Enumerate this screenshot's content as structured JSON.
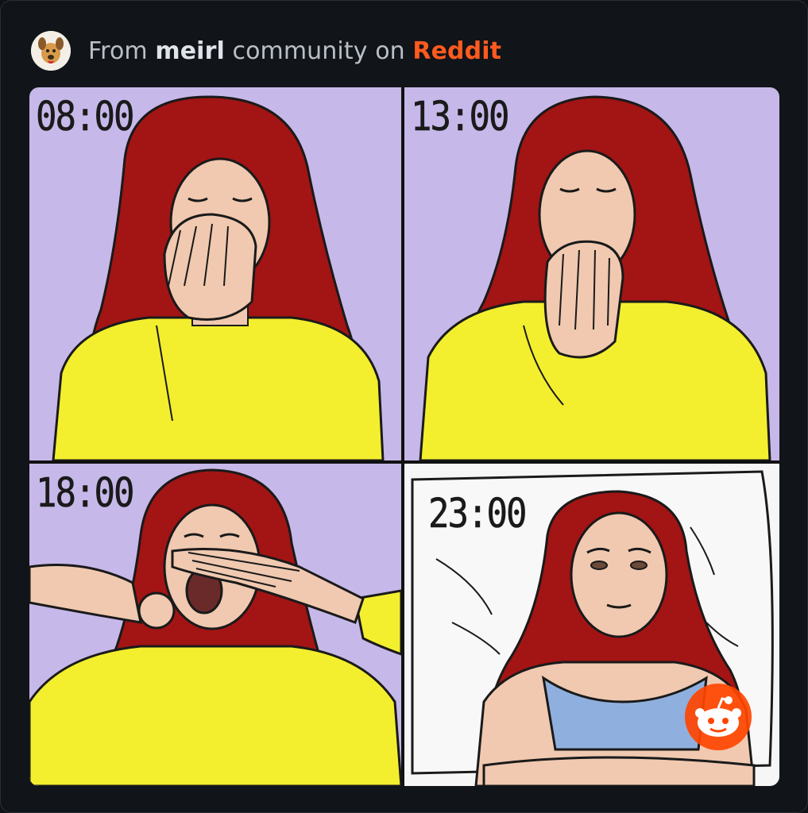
{
  "header": {
    "prefix": "From",
    "community": "meirl",
    "middle": "community on",
    "brand": "Reddit",
    "avatar_icon": "community-avatar-icon"
  },
  "comic": {
    "panels": [
      {
        "time": "08:00",
        "bg": "#c7b8ea"
      },
      {
        "time": "13:00",
        "bg": "#c7b8ea"
      },
      {
        "time": "18:00",
        "bg": "#c7b8ea"
      },
      {
        "time": "23:00",
        "bg": "#f6f6f6"
      }
    ]
  },
  "colors": {
    "brand": "#ff5a1f",
    "hair": "#a31414",
    "sweater": "#f3ef2e",
    "skin": "#f0c9b0",
    "tank_top": "#8fb0de",
    "panel_bg": "#c7b8ea"
  },
  "badge": {
    "icon": "reddit-snoo-icon"
  }
}
